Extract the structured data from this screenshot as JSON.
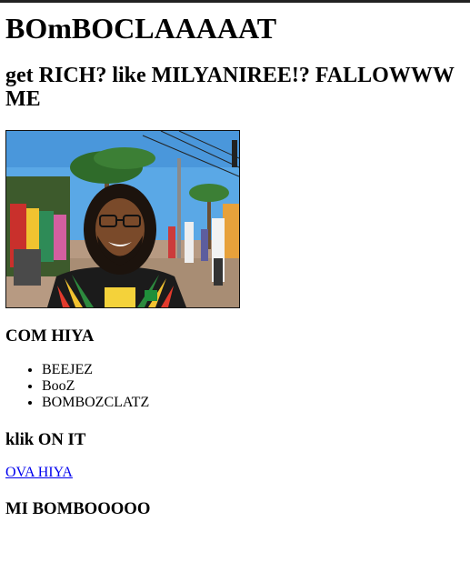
{
  "page": {
    "title": "BOmBOCLAAAAAT",
    "subtitle": "get RICH? like MILYANIREE!? FALLOWWW ME",
    "section_come": "COM HIYA",
    "list_items": [
      "BEEJEZ",
      "BooZ",
      "BOMBOZCLATZ"
    ],
    "section_click": "klik ON IT",
    "link_text": "OVA HIYA",
    "section_footer": "MI BOMBOOOOO"
  },
  "colors": {
    "link": "#0000ee",
    "top_rule": "#222222"
  },
  "icons": {
    "list_bullet": "disc"
  }
}
